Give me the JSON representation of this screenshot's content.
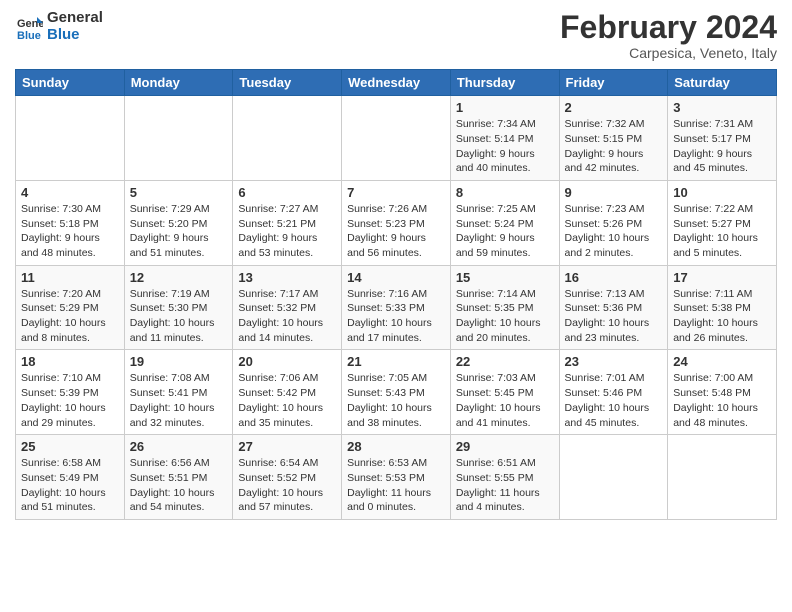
{
  "header": {
    "logo_line1": "General",
    "logo_line2": "Blue",
    "month": "February 2024",
    "location": "Carpesica, Veneto, Italy"
  },
  "weekdays": [
    "Sunday",
    "Monday",
    "Tuesday",
    "Wednesday",
    "Thursday",
    "Friday",
    "Saturday"
  ],
  "weeks": [
    [
      {
        "day": "",
        "info": ""
      },
      {
        "day": "",
        "info": ""
      },
      {
        "day": "",
        "info": ""
      },
      {
        "day": "",
        "info": ""
      },
      {
        "day": "1",
        "info": "Sunrise: 7:34 AM\nSunset: 5:14 PM\nDaylight: 9 hours\nand 40 minutes."
      },
      {
        "day": "2",
        "info": "Sunrise: 7:32 AM\nSunset: 5:15 PM\nDaylight: 9 hours\nand 42 minutes."
      },
      {
        "day": "3",
        "info": "Sunrise: 7:31 AM\nSunset: 5:17 PM\nDaylight: 9 hours\nand 45 minutes."
      }
    ],
    [
      {
        "day": "4",
        "info": "Sunrise: 7:30 AM\nSunset: 5:18 PM\nDaylight: 9 hours\nand 48 minutes."
      },
      {
        "day": "5",
        "info": "Sunrise: 7:29 AM\nSunset: 5:20 PM\nDaylight: 9 hours\nand 51 minutes."
      },
      {
        "day": "6",
        "info": "Sunrise: 7:27 AM\nSunset: 5:21 PM\nDaylight: 9 hours\nand 53 minutes."
      },
      {
        "day": "7",
        "info": "Sunrise: 7:26 AM\nSunset: 5:23 PM\nDaylight: 9 hours\nand 56 minutes."
      },
      {
        "day": "8",
        "info": "Sunrise: 7:25 AM\nSunset: 5:24 PM\nDaylight: 9 hours\nand 59 minutes."
      },
      {
        "day": "9",
        "info": "Sunrise: 7:23 AM\nSunset: 5:26 PM\nDaylight: 10 hours\nand 2 minutes."
      },
      {
        "day": "10",
        "info": "Sunrise: 7:22 AM\nSunset: 5:27 PM\nDaylight: 10 hours\nand 5 minutes."
      }
    ],
    [
      {
        "day": "11",
        "info": "Sunrise: 7:20 AM\nSunset: 5:29 PM\nDaylight: 10 hours\nand 8 minutes."
      },
      {
        "day": "12",
        "info": "Sunrise: 7:19 AM\nSunset: 5:30 PM\nDaylight: 10 hours\nand 11 minutes."
      },
      {
        "day": "13",
        "info": "Sunrise: 7:17 AM\nSunset: 5:32 PM\nDaylight: 10 hours\nand 14 minutes."
      },
      {
        "day": "14",
        "info": "Sunrise: 7:16 AM\nSunset: 5:33 PM\nDaylight: 10 hours\nand 17 minutes."
      },
      {
        "day": "15",
        "info": "Sunrise: 7:14 AM\nSunset: 5:35 PM\nDaylight: 10 hours\nand 20 minutes."
      },
      {
        "day": "16",
        "info": "Sunrise: 7:13 AM\nSunset: 5:36 PM\nDaylight: 10 hours\nand 23 minutes."
      },
      {
        "day": "17",
        "info": "Sunrise: 7:11 AM\nSunset: 5:38 PM\nDaylight: 10 hours\nand 26 minutes."
      }
    ],
    [
      {
        "day": "18",
        "info": "Sunrise: 7:10 AM\nSunset: 5:39 PM\nDaylight: 10 hours\nand 29 minutes."
      },
      {
        "day": "19",
        "info": "Sunrise: 7:08 AM\nSunset: 5:41 PM\nDaylight: 10 hours\nand 32 minutes."
      },
      {
        "day": "20",
        "info": "Sunrise: 7:06 AM\nSunset: 5:42 PM\nDaylight: 10 hours\nand 35 minutes."
      },
      {
        "day": "21",
        "info": "Sunrise: 7:05 AM\nSunset: 5:43 PM\nDaylight: 10 hours\nand 38 minutes."
      },
      {
        "day": "22",
        "info": "Sunrise: 7:03 AM\nSunset: 5:45 PM\nDaylight: 10 hours\nand 41 minutes."
      },
      {
        "day": "23",
        "info": "Sunrise: 7:01 AM\nSunset: 5:46 PM\nDaylight: 10 hours\nand 45 minutes."
      },
      {
        "day": "24",
        "info": "Sunrise: 7:00 AM\nSunset: 5:48 PM\nDaylight: 10 hours\nand 48 minutes."
      }
    ],
    [
      {
        "day": "25",
        "info": "Sunrise: 6:58 AM\nSunset: 5:49 PM\nDaylight: 10 hours\nand 51 minutes."
      },
      {
        "day": "26",
        "info": "Sunrise: 6:56 AM\nSunset: 5:51 PM\nDaylight: 10 hours\nand 54 minutes."
      },
      {
        "day": "27",
        "info": "Sunrise: 6:54 AM\nSunset: 5:52 PM\nDaylight: 10 hours\nand 57 minutes."
      },
      {
        "day": "28",
        "info": "Sunrise: 6:53 AM\nSunset: 5:53 PM\nDaylight: 11 hours\nand 0 minutes."
      },
      {
        "day": "29",
        "info": "Sunrise: 6:51 AM\nSunset: 5:55 PM\nDaylight: 11 hours\nand 4 minutes."
      },
      {
        "day": "",
        "info": ""
      },
      {
        "day": "",
        "info": ""
      }
    ]
  ]
}
